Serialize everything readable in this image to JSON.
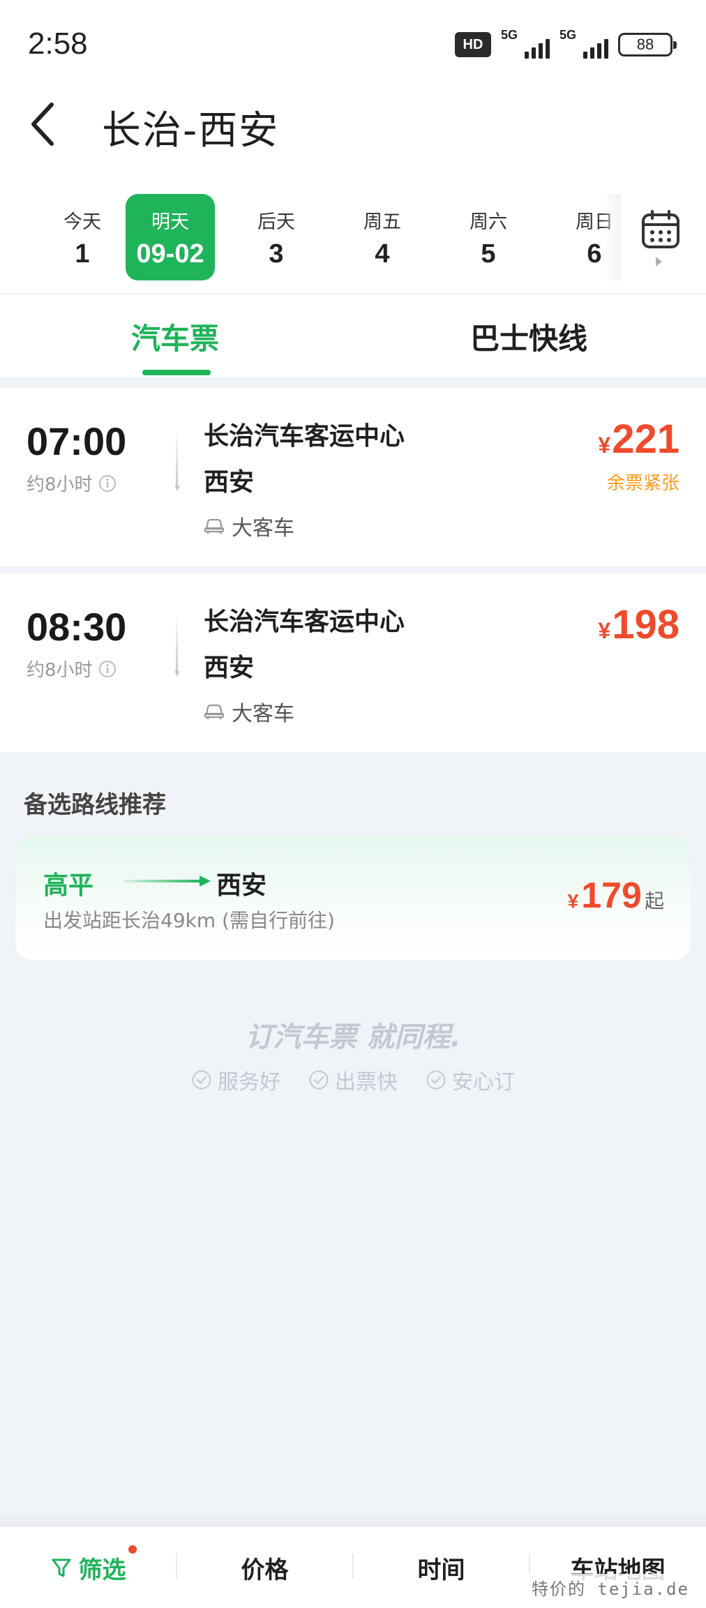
{
  "status_bar": {
    "time": "2:58",
    "hd_label": "HD",
    "sim1_label": "5G",
    "sim2_label": "5G",
    "battery": "88"
  },
  "header": {
    "title": "长治-西安",
    "back_icon": "chevron-left-icon"
  },
  "date_strip": {
    "items": [
      {
        "label": "今天",
        "value": "1",
        "selected": false
      },
      {
        "label": "明天",
        "value": "09-02",
        "selected": true
      },
      {
        "label": "后天",
        "value": "3",
        "selected": false
      },
      {
        "label": "周五",
        "value": "4",
        "selected": false
      },
      {
        "label": "周六",
        "value": "5",
        "selected": false
      },
      {
        "label": "周日",
        "value": "6",
        "selected": false
      }
    ],
    "calendar_icon": "calendar-icon"
  },
  "tabs": [
    {
      "label": "汽车票",
      "active": true
    },
    {
      "label": "巴士快线",
      "active": false
    }
  ],
  "trips": [
    {
      "time": "07:00",
      "duration": "约8小时",
      "from": "长治汽车客运中心",
      "to": "西安",
      "vehicle": "大客车",
      "currency": "¥",
      "price": "221",
      "note": "余票紧张"
    },
    {
      "time": "08:30",
      "duration": "约8小时",
      "from": "长治汽车客运中心",
      "to": "西安",
      "vehicle": "大客车",
      "currency": "¥",
      "price": "198",
      "note": ""
    }
  ],
  "alternative": {
    "section_title": "备选路线推荐",
    "from": "高平",
    "to": "西安",
    "subtitle": "出发站距长治49km (需自行前往)",
    "currency": "¥",
    "price": "179",
    "suffix": "起"
  },
  "slogan": {
    "text": "订汽车票 就同程.",
    "features": [
      "服务好",
      "出票快",
      "安心订"
    ]
  },
  "bottom_bar": {
    "items": [
      {
        "label": "筛选",
        "icon": "funnel-icon",
        "has_dot": true
      },
      {
        "label": "价格"
      },
      {
        "label": "时间"
      },
      {
        "label": "车站地图"
      }
    ]
  },
  "watermark": "特价的 tejia.de",
  "colors": {
    "accent_green": "#1fb35a",
    "price_red": "#f04a2c",
    "warning_orange": "#ff9a1f",
    "background": "#f0f3f8"
  }
}
